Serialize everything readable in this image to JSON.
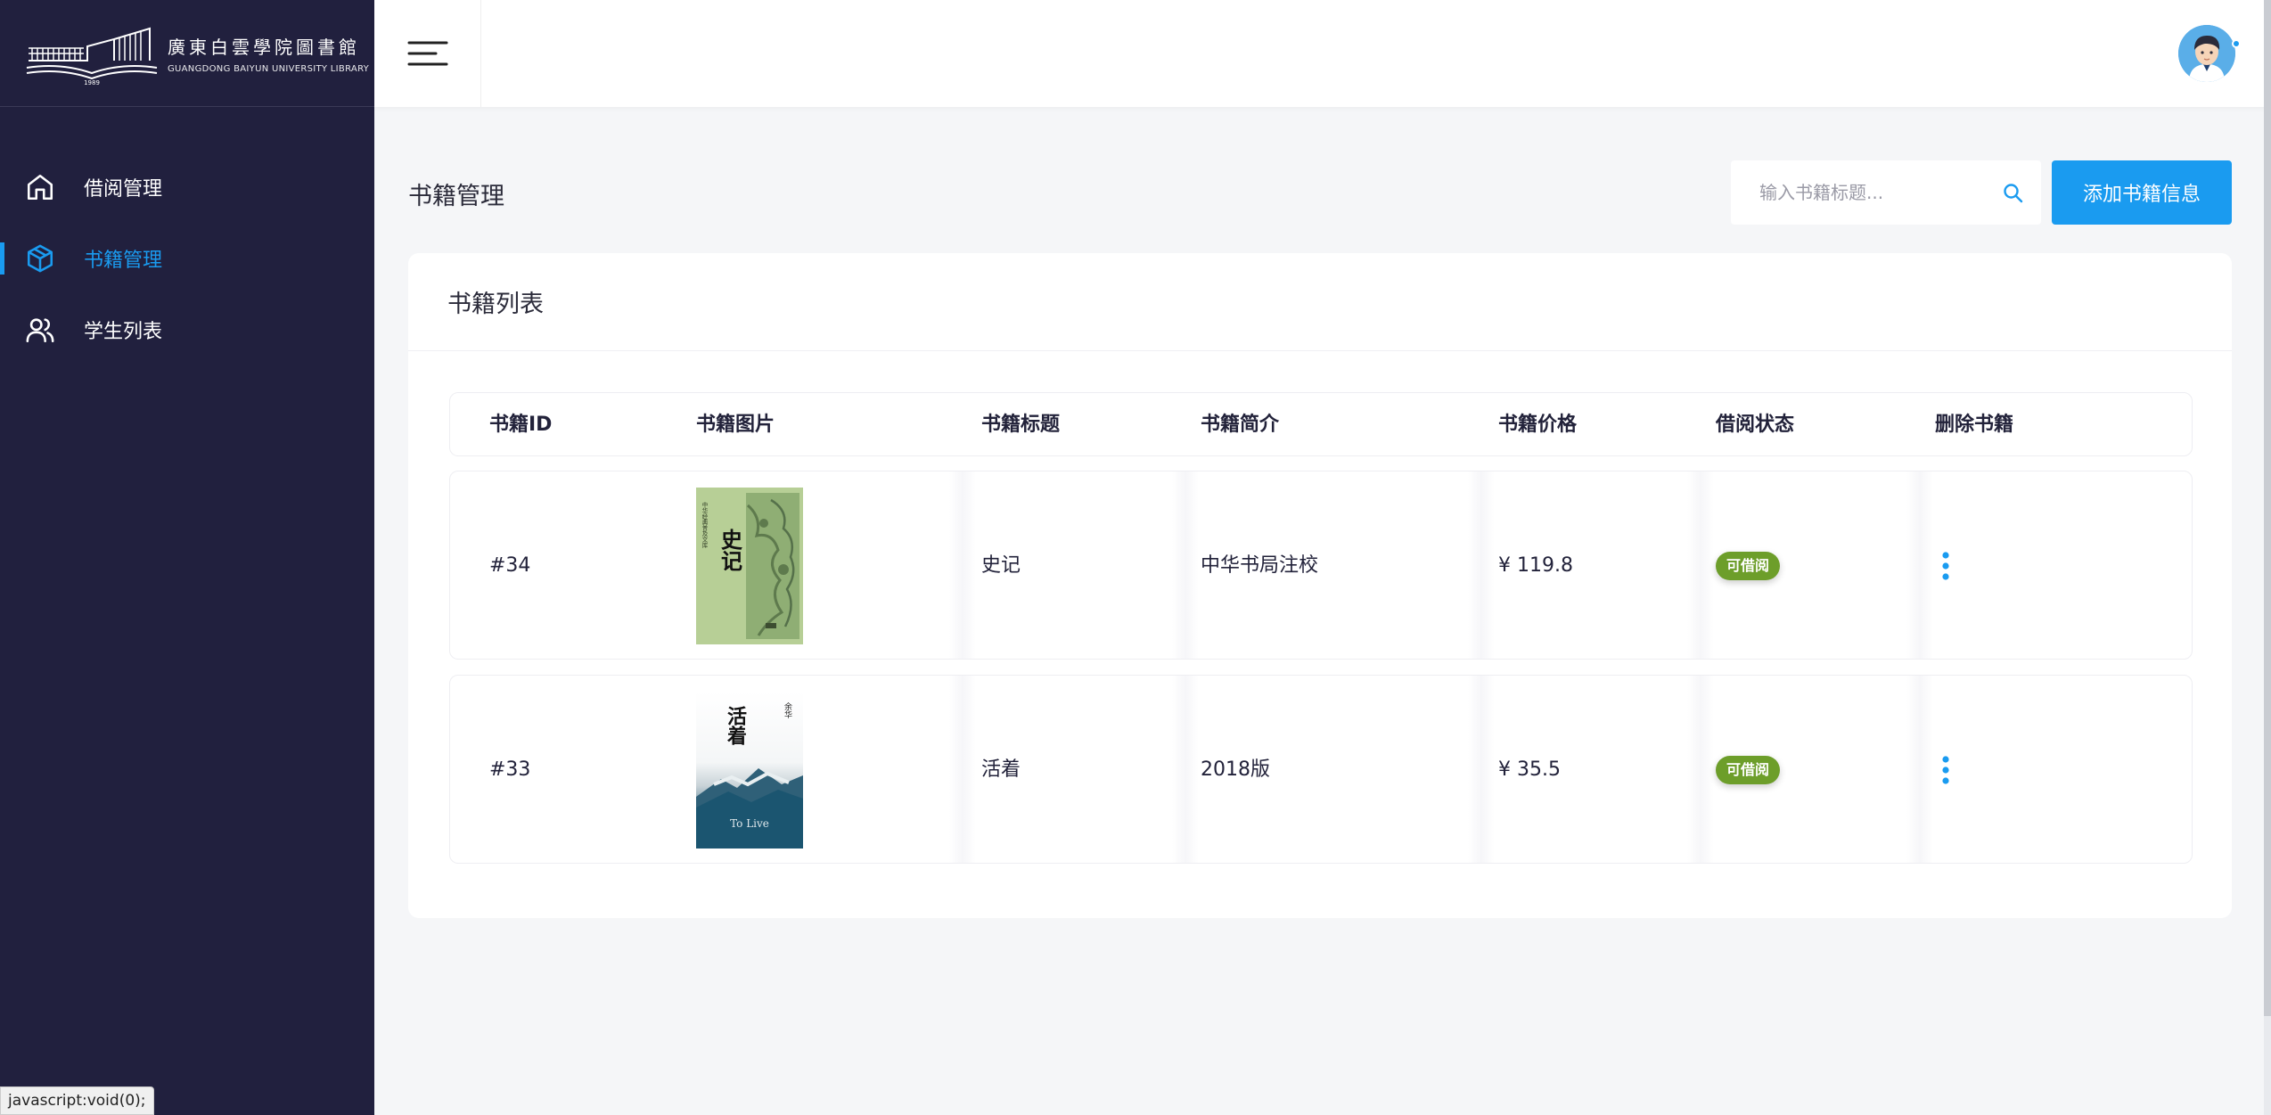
{
  "sidebar": {
    "logo_cn": "廣東白雲學院圖書館",
    "logo_en": "GUANGDONG BAIYUN UNIVERSITY LIBRARY",
    "logo_year": "1989",
    "items": [
      {
        "label": "借阅管理",
        "icon": "home-icon",
        "active": false
      },
      {
        "label": "书籍管理",
        "icon": "box-icon",
        "active": true
      },
      {
        "label": "学生列表",
        "icon": "users-icon",
        "active": false
      }
    ]
  },
  "header": {
    "menu_icon": "hamburger-icon",
    "avatar_icon": "user-avatar"
  },
  "page": {
    "title": "书籍管理",
    "search_placeholder": "输入书籍标题...",
    "add_button": "添加书籍信息"
  },
  "table": {
    "title": "书籍列表",
    "columns": [
      "书籍ID",
      "书籍图片",
      "书籍标题",
      "书籍简介",
      "书籍价格",
      "借阅状态",
      "删除书籍"
    ],
    "rows": [
      {
        "id": "#34",
        "image": "shiji-cover",
        "title": "史记",
        "desc": "中华书局注校",
        "price": "¥ 119.8",
        "status": "可借阅"
      },
      {
        "id": "#33",
        "image": "huozhe-cover",
        "title": "活着",
        "desc": "2018版",
        "price": "¥ 35.5",
        "status": "可借阅"
      }
    ]
  },
  "covers": {
    "shiji_title": "史记",
    "shiji_series": "中华经典普及文库",
    "huozhe_title": "活着",
    "huozhe_author": "余华",
    "huozhe_en": "To Live"
  },
  "status_bar": "javascript:void(0);",
  "colors": {
    "sidebar_bg": "#21203e",
    "accent": "#1a9bf0",
    "badge_green": "#6d9e2a",
    "page_bg": "#f5f6f8"
  }
}
